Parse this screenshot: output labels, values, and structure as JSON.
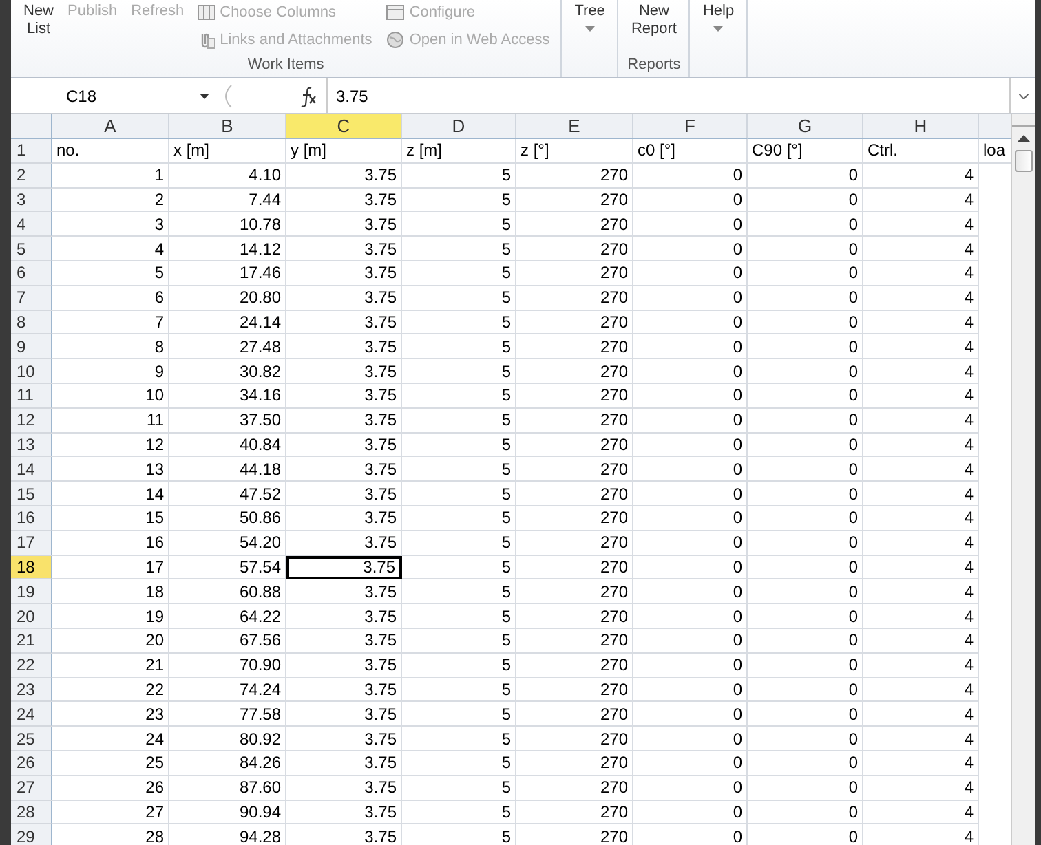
{
  "ribbon": {
    "groups": [
      {
        "label": "Work Items",
        "large": [
          {
            "label": "New List",
            "disabled": false,
            "caret": false
          },
          {
            "label": "Publish",
            "disabled": true,
            "caret": false
          },
          {
            "label": "Refresh",
            "disabled": true,
            "caret": false
          }
        ],
        "small": [
          {
            "label": "Choose Columns",
            "disabled": true,
            "kind": "columns"
          },
          {
            "label": "Links and Attachments",
            "disabled": true,
            "kind": "clip"
          },
          {
            "label": "Configure",
            "disabled": true,
            "kind": "config"
          },
          {
            "label": "Open in Web Access",
            "disabled": true,
            "kind": "globe"
          }
        ]
      },
      {
        "large": [
          {
            "label": "Tree",
            "disabled": false,
            "caret": true
          }
        ]
      },
      {
        "label": "Reports",
        "large": [
          {
            "label": "New Report",
            "disabled": false,
            "caret": false
          }
        ]
      },
      {
        "large": [
          {
            "label": "Help",
            "disabled": false,
            "caret": true
          }
        ]
      }
    ]
  },
  "formula_bar": {
    "name_box": "C18",
    "value": "3.75"
  },
  "sheet": {
    "columns": [
      {
        "label": "A",
        "selected": false
      },
      {
        "label": "B",
        "selected": false
      },
      {
        "label": "C",
        "selected": true
      },
      {
        "label": "D",
        "selected": false
      },
      {
        "label": "E",
        "selected": false
      },
      {
        "label": "F",
        "selected": false
      },
      {
        "label": "G",
        "selected": false
      },
      {
        "label": "H",
        "selected": false
      },
      {
        "selected": false
      }
    ],
    "header_row": {
      "number": "1",
      "selected": false,
      "cells": [
        "no.",
        "x [m]",
        "y [m]",
        "z [m]",
        "z [°]",
        "c0 [°]",
        "C90 [°]",
        "Ctrl.",
        "loa"
      ]
    },
    "rows": [
      {
        "number": "2",
        "selected": false,
        "cells": [
          "1",
          "4.10",
          "3.75",
          "5",
          "270",
          "0",
          "0",
          "4"
        ]
      },
      {
        "number": "3",
        "selected": false,
        "cells": [
          "2",
          "7.44",
          "3.75",
          "5",
          "270",
          "0",
          "0",
          "4"
        ]
      },
      {
        "number": "4",
        "selected": false,
        "cells": [
          "3",
          "10.78",
          "3.75",
          "5",
          "270",
          "0",
          "0",
          "4"
        ]
      },
      {
        "number": "5",
        "selected": false,
        "cells": [
          "4",
          "14.12",
          "3.75",
          "5",
          "270",
          "0",
          "0",
          "4"
        ]
      },
      {
        "number": "6",
        "selected": false,
        "cells": [
          "5",
          "17.46",
          "3.75",
          "5",
          "270",
          "0",
          "0",
          "4"
        ]
      },
      {
        "number": "7",
        "selected": false,
        "cells": [
          "6",
          "20.80",
          "3.75",
          "5",
          "270",
          "0",
          "0",
          "4"
        ]
      },
      {
        "number": "8",
        "selected": false,
        "cells": [
          "7",
          "24.14",
          "3.75",
          "5",
          "270",
          "0",
          "0",
          "4"
        ]
      },
      {
        "number": "9",
        "selected": false,
        "cells": [
          "8",
          "27.48",
          "3.75",
          "5",
          "270",
          "0",
          "0",
          "4"
        ]
      },
      {
        "number": "10",
        "selected": false,
        "cells": [
          "9",
          "30.82",
          "3.75",
          "5",
          "270",
          "0",
          "0",
          "4"
        ]
      },
      {
        "number": "11",
        "selected": false,
        "cells": [
          "10",
          "34.16",
          "3.75",
          "5",
          "270",
          "0",
          "0",
          "4"
        ]
      },
      {
        "number": "12",
        "selected": false,
        "cells": [
          "11",
          "37.50",
          "3.75",
          "5",
          "270",
          "0",
          "0",
          "4"
        ]
      },
      {
        "number": "13",
        "selected": false,
        "cells": [
          "12",
          "40.84",
          "3.75",
          "5",
          "270",
          "0",
          "0",
          "4"
        ]
      },
      {
        "number": "14",
        "selected": false,
        "cells": [
          "13",
          "44.18",
          "3.75",
          "5",
          "270",
          "0",
          "0",
          "4"
        ]
      },
      {
        "number": "15",
        "selected": false,
        "cells": [
          "14",
          "47.52",
          "3.75",
          "5",
          "270",
          "0",
          "0",
          "4"
        ]
      },
      {
        "number": "16",
        "selected": false,
        "cells": [
          "15",
          "50.86",
          "3.75",
          "5",
          "270",
          "0",
          "0",
          "4"
        ]
      },
      {
        "number": "17",
        "selected": false,
        "cells": [
          "16",
          "54.20",
          "3.75",
          "5",
          "270",
          "0",
          "0",
          "4"
        ]
      },
      {
        "number": "18",
        "selected": true,
        "cells": [
          "17",
          "57.54",
          "3.75",
          "5",
          "270",
          "0",
          "0",
          "4"
        ]
      },
      {
        "number": "19",
        "selected": false,
        "cells": [
          "18",
          "60.88",
          "3.75",
          "5",
          "270",
          "0",
          "0",
          "4"
        ]
      },
      {
        "number": "20",
        "selected": false,
        "cells": [
          "19",
          "64.22",
          "3.75",
          "5",
          "270",
          "0",
          "0",
          "4"
        ]
      },
      {
        "number": "21",
        "selected": false,
        "cells": [
          "20",
          "67.56",
          "3.75",
          "5",
          "270",
          "0",
          "0",
          "4"
        ]
      },
      {
        "number": "22",
        "selected": false,
        "cells": [
          "21",
          "70.90",
          "3.75",
          "5",
          "270",
          "0",
          "0",
          "4"
        ]
      },
      {
        "number": "23",
        "selected": false,
        "cells": [
          "22",
          "74.24",
          "3.75",
          "5",
          "270",
          "0",
          "0",
          "4"
        ]
      },
      {
        "number": "24",
        "selected": false,
        "cells": [
          "23",
          "77.58",
          "3.75",
          "5",
          "270",
          "0",
          "0",
          "4"
        ]
      },
      {
        "number": "25",
        "selected": false,
        "cells": [
          "24",
          "80.92",
          "3.75",
          "5",
          "270",
          "0",
          "0",
          "4"
        ]
      },
      {
        "number": "26",
        "selected": false,
        "cells": [
          "25",
          "84.26",
          "3.75",
          "5",
          "270",
          "0",
          "0",
          "4"
        ]
      },
      {
        "number": "27",
        "selected": false,
        "cells": [
          "26",
          "87.60",
          "3.75",
          "5",
          "270",
          "0",
          "0",
          "4"
        ]
      },
      {
        "number": "28",
        "selected": false,
        "cells": [
          "27",
          "90.94",
          "3.75",
          "5",
          "270",
          "0",
          "0",
          "4"
        ]
      },
      {
        "number": "29",
        "selected": false,
        "cells": [
          "28",
          "94.28",
          "3.75",
          "5",
          "270",
          "0",
          "0",
          "4"
        ]
      }
    ]
  }
}
